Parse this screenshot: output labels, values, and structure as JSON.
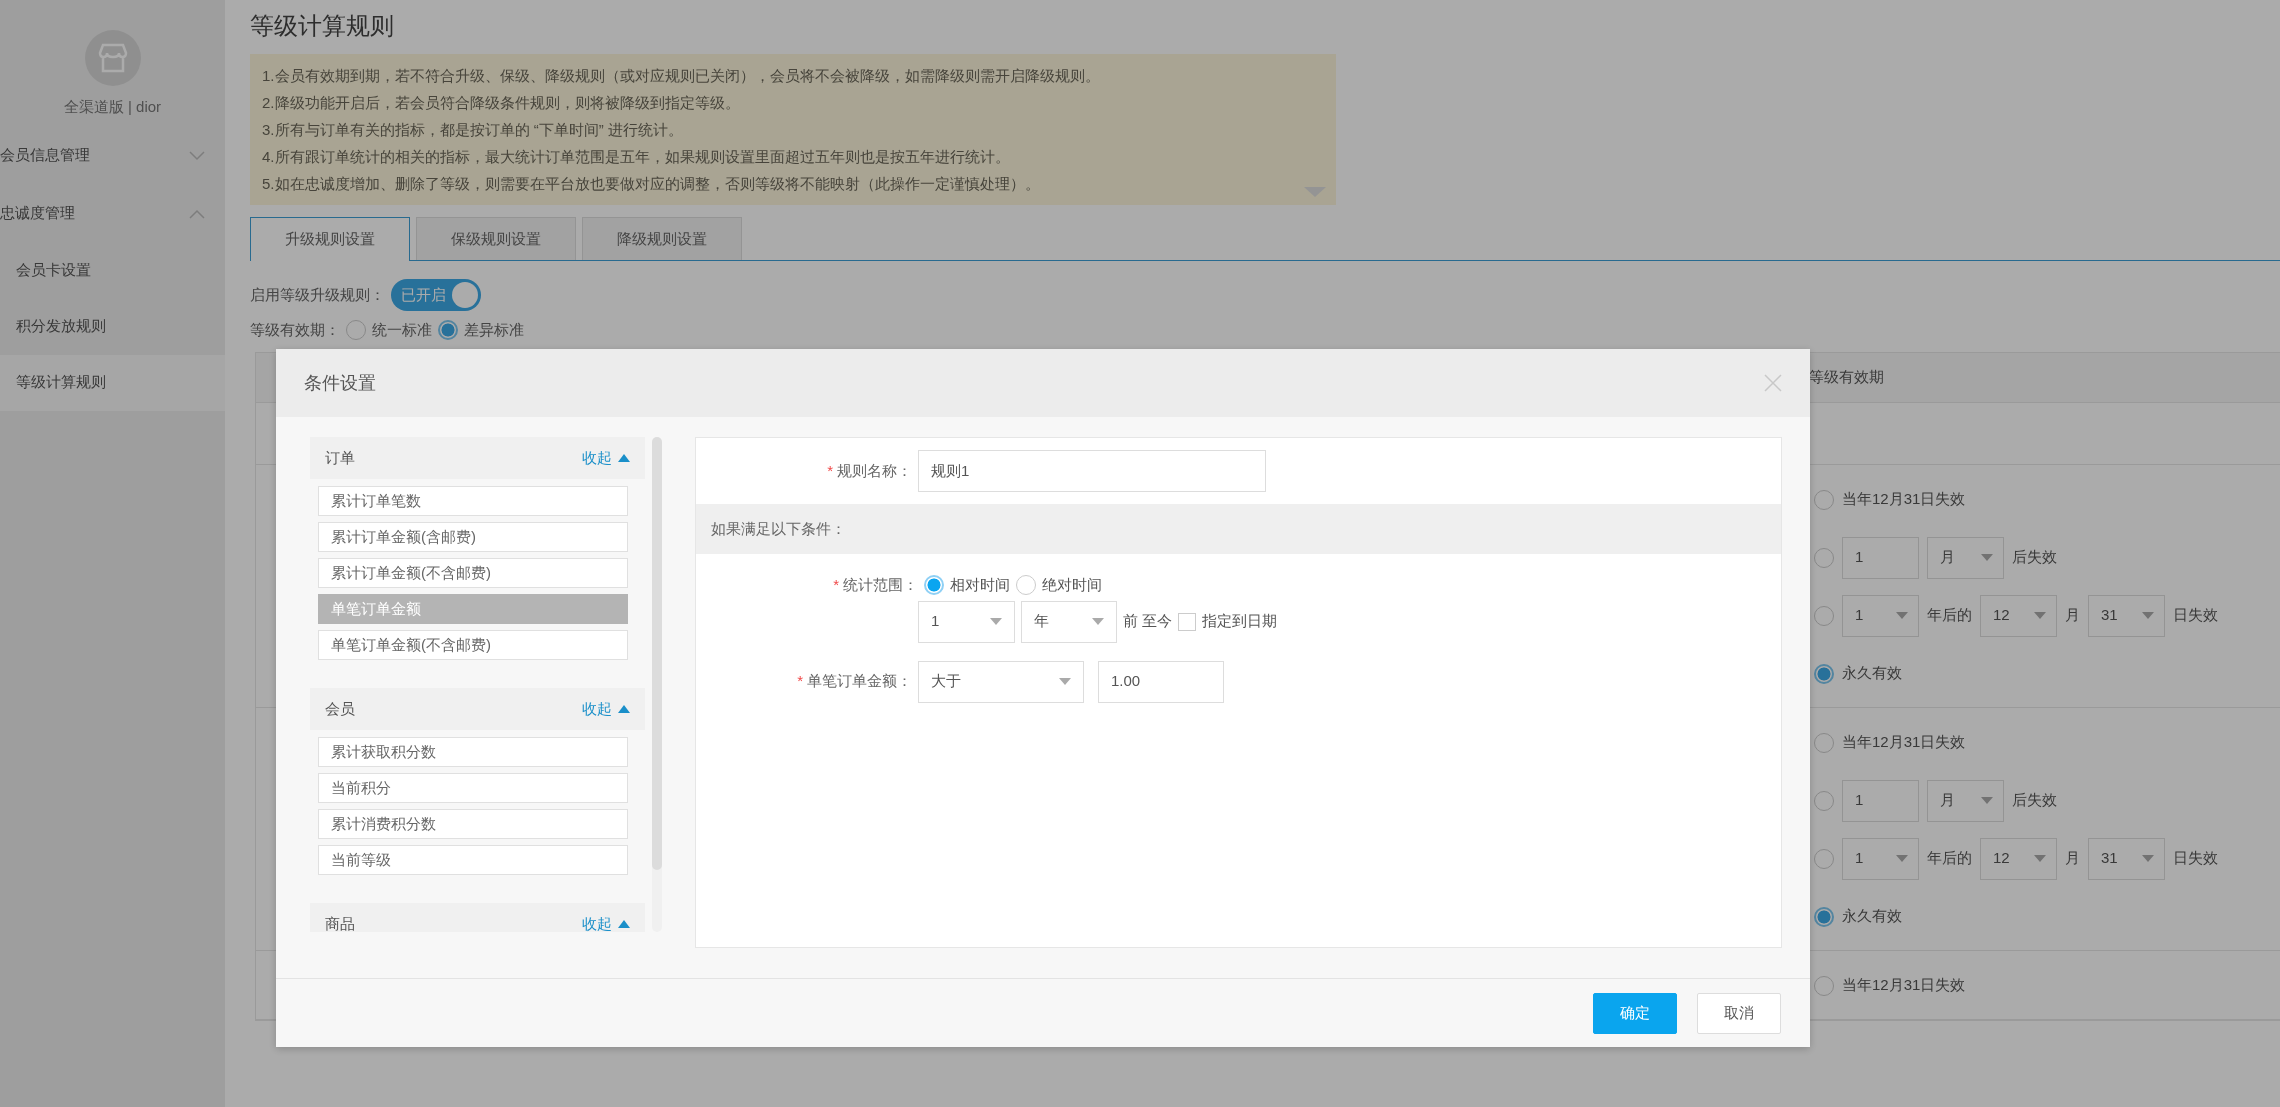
{
  "sidebar": {
    "store": "全渠道版 | dior",
    "items": [
      {
        "label": "会员信息管理",
        "expanded": false
      },
      {
        "label": "忠诚度管理",
        "expanded": true,
        "children": [
          {
            "label": "会员卡设置",
            "selected": false
          },
          {
            "label": "积分发放规则",
            "selected": false
          },
          {
            "label": "等级计算规则",
            "selected": true
          }
        ]
      }
    ]
  },
  "page": {
    "title": "等级计算规则",
    "notices": [
      "1.会员有效期到期，若不符合升级、保级、降级规则（或对应规则已关闭），会员将不会被降级，如需降级则需开启降级规则。",
      "2.降级功能开启后，若会员符合降级条件规则，则将被降级到指定等级。",
      "3.所有与订单有关的指标，都是按订单的 “下单时间” 进行统计。",
      "4.所有跟订单统计的相关的指标，最大统计订单范围是五年，如果规则设置里面超过五年则也是按五年进行统计。",
      "5.如在忠诚度增加、删除了等级，则需要在平台放也要做对应的调整，否则等级将不能映射（此操作一定谨慎处理）。"
    ],
    "tabs": [
      {
        "label": "升级规则设置",
        "selected": true
      },
      {
        "label": "保级规则设置",
        "selected": false
      },
      {
        "label": "降级规则设置",
        "selected": false
      }
    ],
    "upgrade_toggle": {
      "label": "启用等级升级规则：",
      "on": true,
      "text": "已开启"
    },
    "validity_mode": {
      "label": "等级有效期：",
      "options": [
        {
          "label": "统一标准",
          "selected": false
        },
        {
          "label": "差异标准",
          "selected": true
        }
      ]
    },
    "table": {
      "column": "等级有效期",
      "groups": [
        {
          "options": [
            {
              "kind": "fixed",
              "label": "当年12月31日失效",
              "selected": false
            },
            {
              "kind": "after",
              "value": "1",
              "unit": "月",
              "suffix": "后失效",
              "selected": false
            },
            {
              "kind": "date",
              "years": "1",
              "text": "年后的",
              "month": "12",
              "month_text": "月",
              "day": "31",
              "suffix": "日失效",
              "selected": false
            },
            {
              "kind": "fixed",
              "label": "永久有效",
              "selected": true
            }
          ]
        },
        {
          "options": [
            {
              "kind": "fixed",
              "label": "当年12月31日失效",
              "selected": false
            },
            {
              "kind": "after",
              "value": "1",
              "unit": "月",
              "suffix": "后失效",
              "selected": false
            },
            {
              "kind": "date",
              "years": "1",
              "text": "年后的",
              "month": "12",
              "month_text": "月",
              "day": "31",
              "suffix": "日失效",
              "selected": false
            },
            {
              "kind": "fixed",
              "label": "永久有效",
              "selected": true
            }
          ]
        },
        {
          "options": [
            {
              "kind": "fixed",
              "label": "当年12月31日失效",
              "selected": false
            }
          ]
        }
      ]
    }
  },
  "dialog": {
    "title": "条件设置",
    "categories": [
      {
        "name": "订单",
        "toggle": "收起",
        "items": [
          {
            "label": "累计订单笔数",
            "selected": false
          },
          {
            "label": "累计订单金额(含邮费)",
            "selected": false
          },
          {
            "label": "累计订单金额(不含邮费)",
            "selected": false
          },
          {
            "label": "单笔订单金额",
            "selected": true
          },
          {
            "label": "单笔订单金额(不含邮费)",
            "selected": false
          }
        ]
      },
      {
        "name": "会员",
        "toggle": "收起",
        "items": [
          {
            "label": "累计获取积分数",
            "selected": false
          },
          {
            "label": "当前积分",
            "selected": false
          },
          {
            "label": "累计消费积分数",
            "selected": false
          },
          {
            "label": "当前等级",
            "selected": false
          }
        ]
      },
      {
        "name": "商品",
        "toggle": "收起"
      }
    ],
    "form": {
      "required_mark": "*",
      "name_label": "规则名称：",
      "name_value": "规则1",
      "section": "如果满足以下条件：",
      "range_label": "统计范围：",
      "range_options": [
        {
          "label": "相对时间",
          "selected": true
        },
        {
          "label": "绝对时间",
          "selected": false
        }
      ],
      "range_count": "1",
      "range_unit": "年",
      "range_text": "前 至今",
      "specify_date": {
        "label": "指定到日期",
        "checked": false
      },
      "amount_label": "单笔订单金额：",
      "operator": "大于",
      "amount": "1.00"
    },
    "buttons": [
      {
        "label": "确定",
        "kind": "primary"
      },
      {
        "label": "取消",
        "kind": "secondary"
      }
    ]
  }
}
